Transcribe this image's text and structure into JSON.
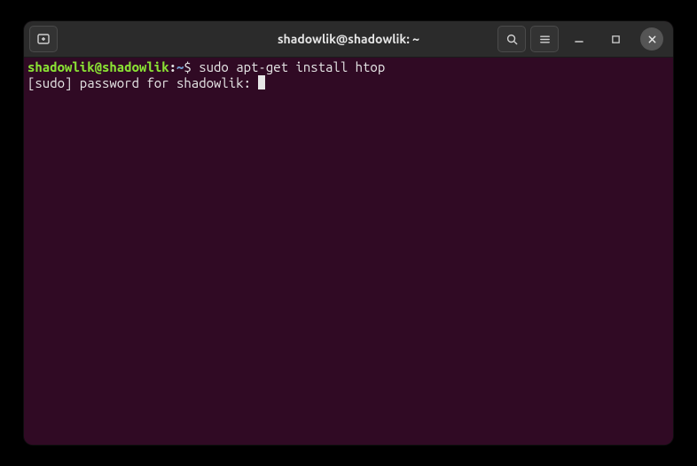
{
  "window": {
    "title": "shadowlik@shadowlik: ~"
  },
  "terminal": {
    "prompt_user_host": "shadowlik@shadowlik",
    "prompt_colon": ":",
    "prompt_path": "~",
    "prompt_dollar": "$ ",
    "command": "sudo apt-get install htop",
    "output_line": "[sudo] password for shadowlik: "
  }
}
